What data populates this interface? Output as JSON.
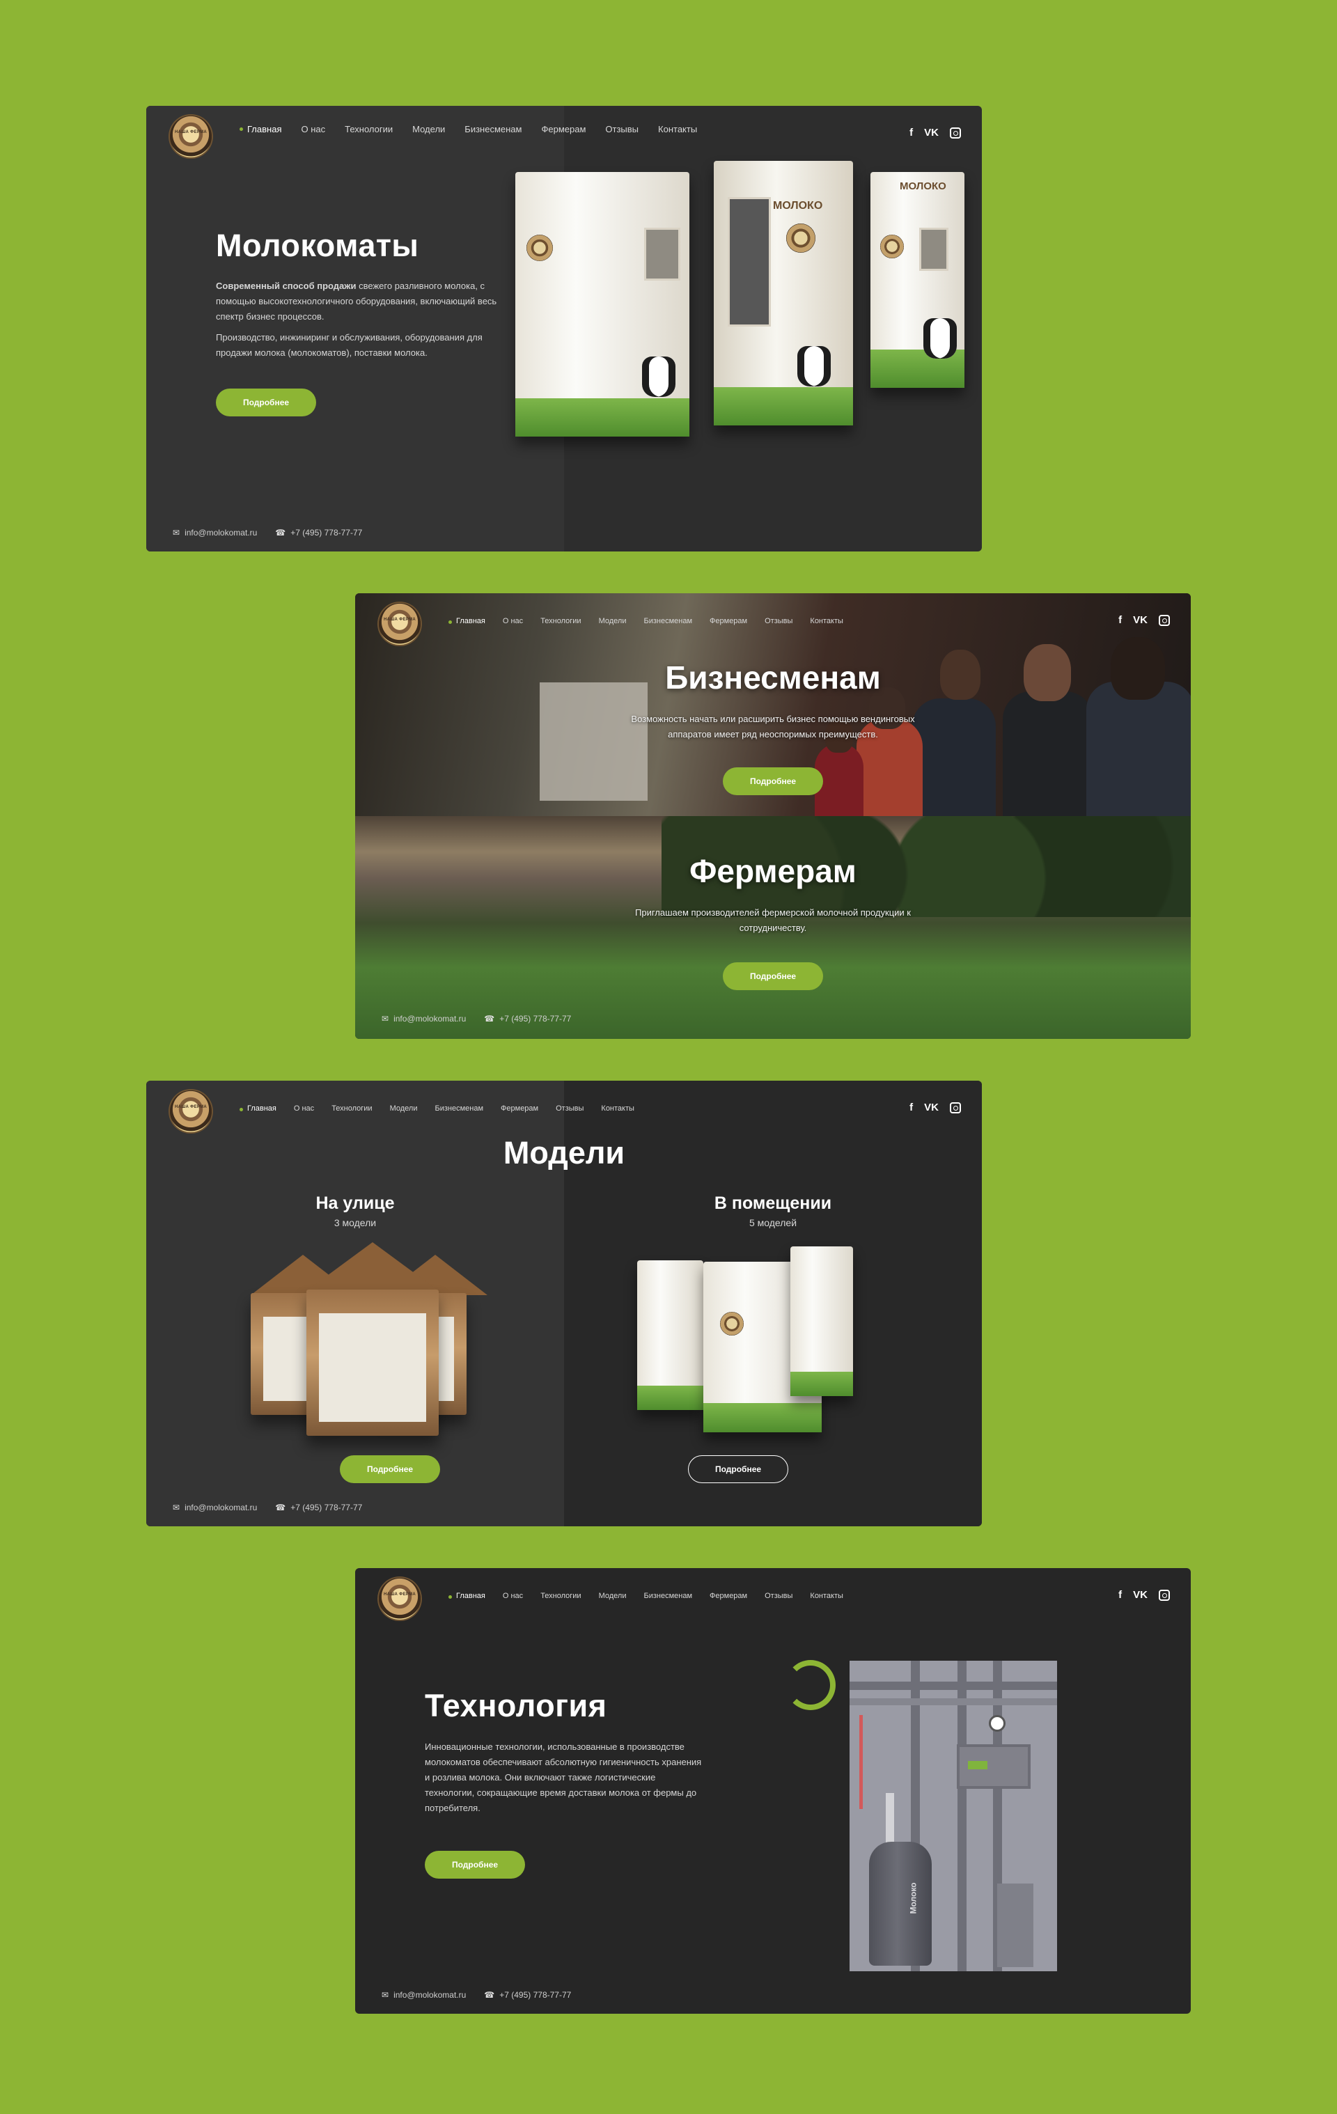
{
  "common": {
    "logo_text": "НАША ФЕРМА",
    "nav": [
      "Главная",
      "О нас",
      "Технологии",
      "Модели",
      "Бизнесменам",
      "Фермерам",
      "Отзывы",
      "Контакты"
    ],
    "social": [
      "f",
      "VK",
      "Instagram"
    ],
    "email": "info@molokomat.ru",
    "phone": "+7 (495) 778-77-77",
    "button": "Подробнее"
  },
  "hero": {
    "title": "Молокоматы",
    "lead_bold": "Современный способ продажи",
    "lead_text": "свежего разливного молока, с помощью высокотехнологичного оборудования, включающий весь спектр бизнес процессов.",
    "paragraph": "Производство, инжиниринг и обслуживания, оборудования для продажи молока (молокоматов), поставки молока.",
    "machine_labels": [
      "МОЛОКО",
      "МОЛОКО"
    ]
  },
  "business": {
    "title": "Бизнесменам",
    "text": "Возможность начать или расширить бизнес помощью вендинговых аппаратов имеет ряд неоспоримых преимуществ."
  },
  "farmers": {
    "title": "Фермерам",
    "text": "Приглашаем производителей фермерской молочной продукции к сотрудничеству."
  },
  "models": {
    "title": "Модели",
    "outdoor_title": "На улице",
    "outdoor_count": "3 модели",
    "indoor_title": "В помещении",
    "indoor_count": "5 моделей"
  },
  "tech": {
    "title": "Технология",
    "text": "Инновационные технологии, использованные в производстве молокоматов обеспечивают абсолютную гигиеничность хранения и розлива молока. Они включают также логистические технологии, сокращающие время доставки молока от фермы до потребителя.",
    "tank_label": "Молоко"
  },
  "colors": {
    "accent": "#8db534",
    "background": "#8db534",
    "panel": "#2d2d2d"
  }
}
